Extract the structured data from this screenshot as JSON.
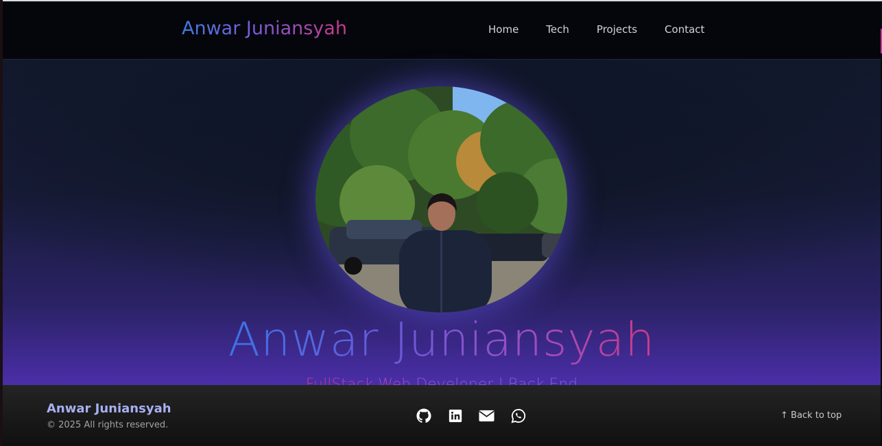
{
  "header": {
    "brand": "Anwar Juniansyah",
    "nav": [
      "Home",
      "Tech",
      "Projects",
      "Contact"
    ]
  },
  "hero": {
    "name": "Anwar Juniansyah",
    "subtitle": "FullStack Web Developer | Back End",
    "photo_icon": "profile-photo"
  },
  "footer": {
    "name": "Anwar Juniansyah",
    "copyright": "© 2025 All rights reserved.",
    "socials": [
      "github-icon",
      "linkedin-icon",
      "envelope-icon",
      "whatsapp-icon"
    ],
    "back_to_top": "↑ Back to top"
  },
  "colors": {
    "accent_blue": "#3f7be0",
    "accent_purple": "#7c5bd4",
    "accent_pink": "#c83a86",
    "footer_name": "#a6b0f0"
  }
}
